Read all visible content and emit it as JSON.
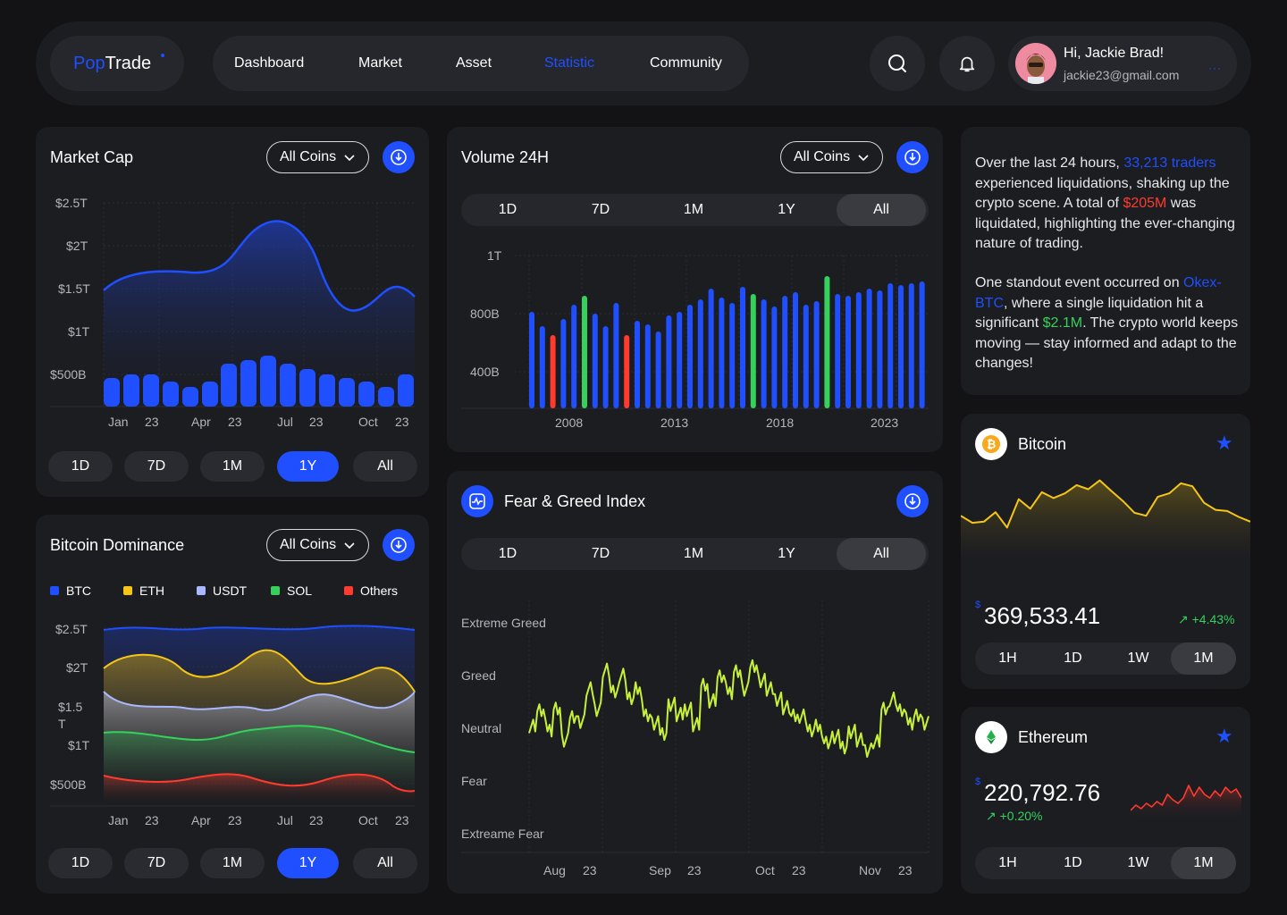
{
  "header": {
    "logo_pop": "Pop",
    "logo_trade": "Trade",
    "nav": [
      {
        "label": "Dashboard",
        "active": false
      },
      {
        "label": "Market",
        "active": false
      },
      {
        "label": "Asset",
        "active": false
      },
      {
        "label": "Statistic",
        "active": true
      },
      {
        "label": "Community",
        "active": false
      }
    ],
    "search_icon": "search-icon",
    "bell_icon": "bell-icon",
    "user": {
      "greeting": "Hi, Jackie Brad!",
      "email": "jackie23@gmail.com"
    }
  },
  "colors": {
    "accent": "#1f4fff",
    "card": "#1c1d21",
    "bg": "#131316",
    "green": "#36d05c",
    "red": "#ff3b2f",
    "yellow": "#f5c518"
  },
  "market_cap": {
    "title": "Market Cap",
    "dropdown": "All Coins",
    "y_labels": [
      "$2.5T",
      "$2T",
      "$1.5T",
      "$1T",
      "$500B"
    ],
    "x_labels": [
      "Jan",
      "23",
      "Apr",
      "23",
      "Jul",
      "23",
      "Oct",
      "23"
    ],
    "ranges": [
      "1D",
      "7D",
      "1M",
      "1Y",
      "All"
    ],
    "active_range": "1Y"
  },
  "bitcoin_dominance": {
    "title": "Bitcoin Dominance",
    "dropdown": "All Coins",
    "legend": [
      {
        "label": "BTC",
        "color": "#1f4fff"
      },
      {
        "label": "ETH",
        "color": "#f5c518"
      },
      {
        "label": "USDT",
        "color": "#aab8ff"
      },
      {
        "label": "SOL",
        "color": "#36d05c"
      },
      {
        "label": "Others",
        "color": "#ff3b2f"
      }
    ],
    "y_labels": [
      "$2.5T",
      "$2T",
      "$1.5",
      "T",
      "$1T",
      "$500B"
    ],
    "x_labels": [
      "Jan",
      "23",
      "Apr",
      "23",
      "Jul",
      "23",
      "Oct",
      "23"
    ],
    "ranges": [
      "1D",
      "7D",
      "1M",
      "1Y",
      "All"
    ],
    "active_range": "1Y"
  },
  "volume": {
    "title": "Volume 24H",
    "dropdown": "All Coins",
    "ranges": [
      "1D",
      "7D",
      "1M",
      "1Y",
      "All"
    ],
    "active_range": "All",
    "y_labels": [
      "1T",
      "800B",
      "400B"
    ],
    "x_labels": [
      "2008",
      "2013",
      "2018",
      "2023"
    ]
  },
  "fear_greed": {
    "title": "Fear & Greed Index",
    "ranges": [
      "1D",
      "7D",
      "1M",
      "1Y",
      "All"
    ],
    "active_range": "All",
    "y_labels": [
      "Extreme Greed",
      "Greed",
      "Neutral",
      "Fear",
      "Extreame Fear"
    ],
    "x_labels": [
      "Aug",
      "23",
      "Sep",
      "23",
      "Oct",
      "23",
      "Nov",
      "23"
    ]
  },
  "news": {
    "p1_a": "Over the last 24 hours, ",
    "p1_traders": "33,213 traders",
    "p1_b": " experienced liquidations, shaking up the crypto scene. A total of ",
    "p1_amount": "$205M",
    "p1_c": " was liquidated, highlighting the ever-changing nature of trading.",
    "p2_a": "One standout event occurred on ",
    "p2_exchange": "Okex-BTC",
    "p2_b": ", where a single liquidation hit a significant ",
    "p2_amount": "$2.1M",
    "p2_c": ". The crypto world keeps moving — stay informed and adapt to the changes!"
  },
  "bitcoin": {
    "name": "Bitcoin",
    "currency": "$",
    "price": "369,533.41",
    "change": "+4.43%",
    "ranges": [
      "1H",
      "1D",
      "1W",
      "1M"
    ],
    "active_range": "1M",
    "sparkline": [
      0.3,
      0.18,
      0.2,
      0.36,
      0.1,
      0.58,
      0.42,
      0.7,
      0.6,
      0.68,
      0.82,
      0.75,
      0.9,
      0.72,
      0.55,
      0.35,
      0.3,
      0.62,
      0.68,
      0.85,
      0.8,
      0.52,
      0.4,
      0.38,
      0.28,
      0.2
    ]
  },
  "ethereum": {
    "name": "Ethereum",
    "currency": "$",
    "price": "220,792.76",
    "change": "+0.20%",
    "ranges": [
      "1H",
      "1D",
      "1W",
      "1M"
    ],
    "active_range": "1M",
    "sparkline": [
      0.15,
      0.3,
      0.2,
      0.35,
      0.25,
      0.4,
      0.3,
      0.6,
      0.45,
      0.35,
      0.5,
      0.85,
      0.55,
      0.8,
      0.6,
      0.5,
      0.7,
      0.55,
      0.8,
      0.65,
      0.75,
      0.5
    ]
  }
}
